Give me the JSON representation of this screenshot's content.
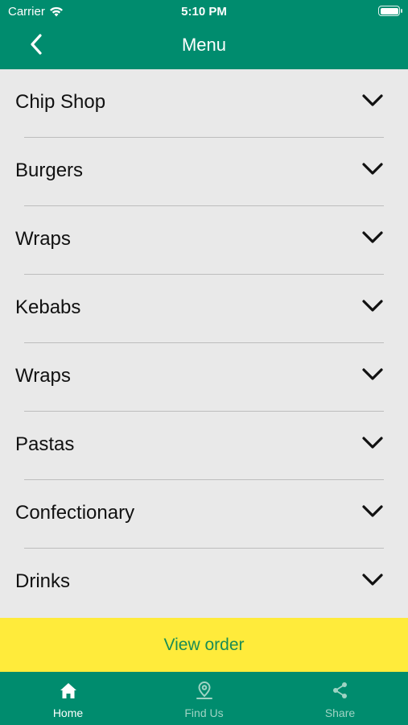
{
  "status_bar": {
    "carrier": "Carrier",
    "time": "5:10 PM"
  },
  "nav": {
    "title": "Menu"
  },
  "menu": {
    "items": [
      {
        "label": "Chip Shop"
      },
      {
        "label": "Burgers"
      },
      {
        "label": "Wraps"
      },
      {
        "label": "Kebabs"
      },
      {
        "label": "Wraps"
      },
      {
        "label": "Pastas"
      },
      {
        "label": "Confectionary"
      },
      {
        "label": "Drinks"
      }
    ]
  },
  "view_order": {
    "label": "View order"
  },
  "tabs": [
    {
      "label": "Home",
      "icon": "home-icon",
      "active": true
    },
    {
      "label": "Find Us",
      "icon": "location-pin-icon",
      "active": false
    },
    {
      "label": "Share",
      "icon": "share-icon",
      "active": false
    }
  ],
  "colors": {
    "brand_green": "#008c6e",
    "view_order_bg": "#ffeb3b",
    "view_order_text": "#1a8c55",
    "list_bg": "#e9e9e9"
  }
}
